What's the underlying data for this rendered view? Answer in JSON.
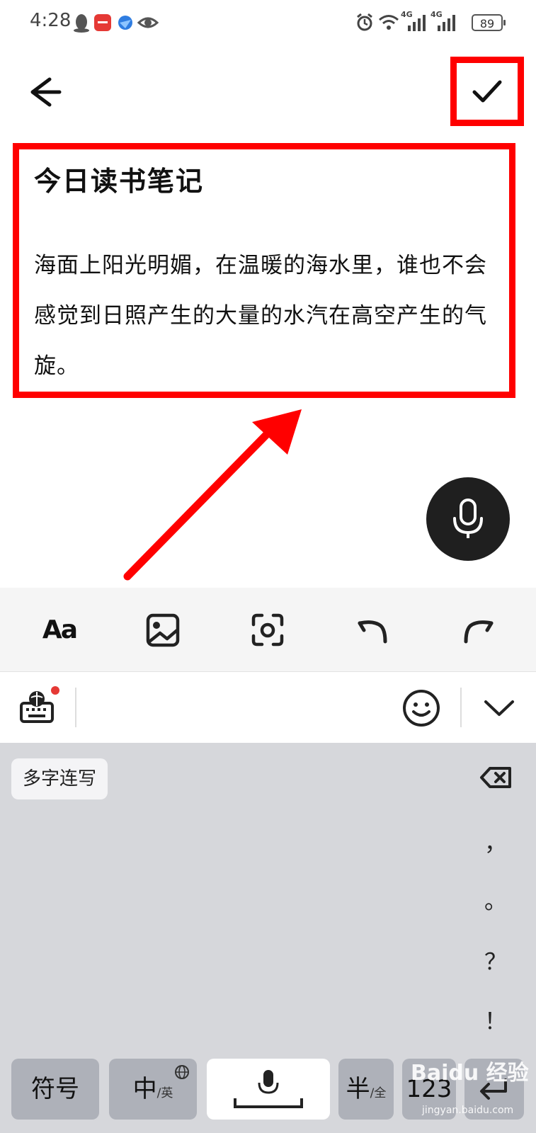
{
  "status_bar": {
    "time": "4:28",
    "battery": "89",
    "network_1": "4G",
    "network_2": "4G"
  },
  "toolbar": {
    "back_icon": "arrow-left-icon",
    "confirm_icon": "checkmark-icon"
  },
  "note": {
    "title": "今日读书笔记",
    "body": "海面上阳光明媚，在温暖的海水里，谁也不会感觉到日照产生的大量的水汽在高空产生的气旋。"
  },
  "format_bar": {
    "text_style_label": "Aa",
    "items": [
      "text-style-icon",
      "image-icon",
      "scan-icon",
      "undo-icon",
      "redo-icon"
    ]
  },
  "keyboard": {
    "mode_chip": "多字连写",
    "punctuation": [
      "，",
      "。",
      "？",
      "！"
    ],
    "keys": {
      "symbols": "符号",
      "chinese_main": "中",
      "chinese_sub": "/英",
      "half_main": "半",
      "half_sub": "/全",
      "numbers": "123"
    }
  },
  "watermark": {
    "brand": "Baidu 经验",
    "url": "jingyan.baidu.com"
  },
  "colors": {
    "highlight": "#ff0000",
    "fab": "#1f1f1f",
    "keyboard_bg": "#d6d7db",
    "notification_dot": "#e53935"
  }
}
